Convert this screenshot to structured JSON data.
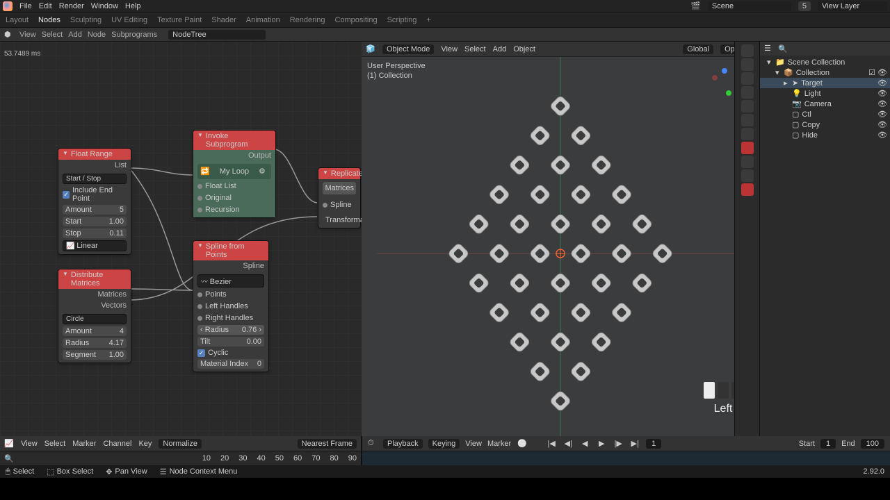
{
  "menu": {
    "items": [
      "File",
      "Edit",
      "Render",
      "Window",
      "Help"
    ]
  },
  "workspaces": {
    "items": [
      "Layout",
      "Nodes",
      "Sculpting",
      "UV Editing",
      "Texture Paint",
      "Shader",
      "Animation",
      "Rendering",
      "Compositing",
      "Scripting"
    ],
    "active": "Nodes"
  },
  "scene": {
    "name": "Scene",
    "layer": "View Layer",
    "version_badge": "5"
  },
  "node_header": {
    "menu": [
      "View",
      "Select",
      "Add",
      "Node",
      "Subprograms"
    ],
    "tree": "NodeTree"
  },
  "perf": {
    "ms": "53.7489 ms"
  },
  "nodes": {
    "float_range": {
      "title": "Float Range",
      "out": "List",
      "mode": "Start / Stop",
      "include_end": "Include End Point",
      "amount_l": "Amount",
      "amount_v": "5",
      "start_l": "Start",
      "start_v": "1.00",
      "stop_l": "Stop",
      "stop_v": "0.11",
      "interp": "Linear"
    },
    "distribute": {
      "title": "Distribute Matrices",
      "out1": "Matrices",
      "out2": "Vectors",
      "shape": "Circle",
      "amount_l": "Amount",
      "amount_v": "4",
      "radius_l": "Radius",
      "radius_v": "4.17",
      "segment_l": "Segment",
      "segment_v": "1.00"
    },
    "invoke": {
      "title": "Invoke Subprogram",
      "out": "Output",
      "sub_name": "My Loop",
      "in1": "Float List",
      "in2": "Original",
      "in3": "Recursion"
    },
    "spline": {
      "title": "Spline from Points",
      "out": "Spline",
      "type": "Bezier",
      "in_points": "Points",
      "in_lh": "Left Handles",
      "in_rh": "Right Handles",
      "radius_l": "Radius",
      "radius_v": "0.76",
      "tilt_l": "Tilt",
      "tilt_v": "0.00",
      "cyclic": "Cyclic",
      "matidx_l": "Material Index",
      "matidx_v": "0"
    },
    "replicate": {
      "title": "Replicate",
      "out": "Matrices",
      "in1": "Spline",
      "in2": "Transformati"
    }
  },
  "viewport": {
    "mode": "Object Mode",
    "menu": [
      "View",
      "Select",
      "Add",
      "Object"
    ],
    "orientation": "Global",
    "overlay1": "User Perspective",
    "overlay2": "(1) Collection",
    "options": "Options",
    "mouse_label": "Left"
  },
  "outliner": {
    "root": "Scene Collection",
    "collection": "Collection",
    "items": [
      {
        "name": "Target",
        "active": true
      },
      {
        "name": "Light",
        "active": false
      },
      {
        "name": "Camera",
        "active": false
      },
      {
        "name": "Ctl",
        "active": false
      },
      {
        "name": "Copy",
        "active": false
      },
      {
        "name": "Hide",
        "active": false
      }
    ]
  },
  "timeline": {
    "left_menu": [
      "View",
      "Select",
      "Marker",
      "Channel",
      "Key"
    ],
    "normalize": "Normalize",
    "nearest": "Nearest Frame",
    "ticks": [
      "10",
      "20",
      "30",
      "40",
      "50",
      "60",
      "70",
      "80",
      "90"
    ],
    "playback": "Playback",
    "keying": "Keying",
    "view": "View",
    "marker": "Marker",
    "current": "1",
    "start_l": "Start",
    "start_v": "1",
    "end_l": "End",
    "end_v": "100"
  },
  "status": {
    "select": "Select",
    "box": "Box Select",
    "pan": "Pan View",
    "ctx": "Node Context Menu",
    "ver": "2.92.0"
  }
}
